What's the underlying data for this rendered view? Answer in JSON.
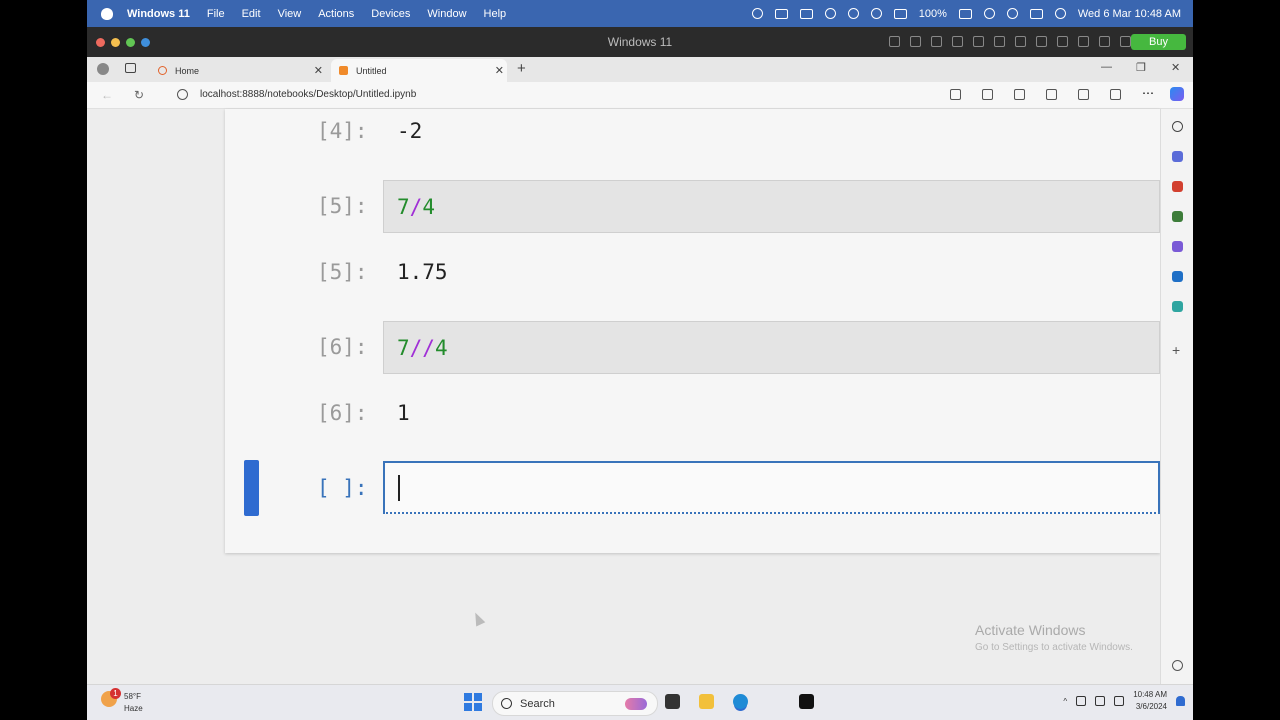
{
  "mac_menubar": {
    "app_name": "Windows 11",
    "menus": [
      "File",
      "Edit",
      "View",
      "Actions",
      "Devices",
      "Window",
      "Help"
    ],
    "battery": "100%",
    "datetime": "Wed 6 Mar  10:48 AM"
  },
  "vm_titlebar": {
    "title": "Windows 11",
    "buy_label": "Buy",
    "accent": "#46b83f"
  },
  "browser": {
    "tabs": [
      {
        "label": "Home",
        "active": false
      },
      {
        "label": "Untitled",
        "active": true
      }
    ],
    "url": "localhost:8888/notebooks/Desktop/Untitled.ipynb"
  },
  "notebook": {
    "cells": [
      {
        "prompt": "[4]:",
        "type": "output",
        "text": "-2"
      },
      {
        "prompt": "[5]:",
        "type": "input",
        "tokens": [
          {
            "t": "7",
            "k": "num"
          },
          {
            "t": "/",
            "k": "op"
          },
          {
            "t": "4",
            "k": "num"
          }
        ]
      },
      {
        "prompt": "[5]:",
        "type": "output",
        "text": "1.75"
      },
      {
        "prompt": "[6]:",
        "type": "input",
        "tokens": [
          {
            "t": "7",
            "k": "num"
          },
          {
            "t": "//",
            "k": "op"
          },
          {
            "t": "4",
            "k": "num"
          }
        ]
      },
      {
        "prompt": "[6]:",
        "type": "output",
        "text": "1"
      },
      {
        "prompt": "[ ]:",
        "type": "active_input",
        "text": ""
      }
    ]
  },
  "watermark": {
    "line1": "Activate Windows",
    "line2": "Go to Settings to activate Windows."
  },
  "taskbar": {
    "temperature": "58°F",
    "weather": "Haze",
    "weather_badge": "1",
    "search_label": "Search",
    "time": "10:48 AM",
    "date": "3/6/2024"
  }
}
